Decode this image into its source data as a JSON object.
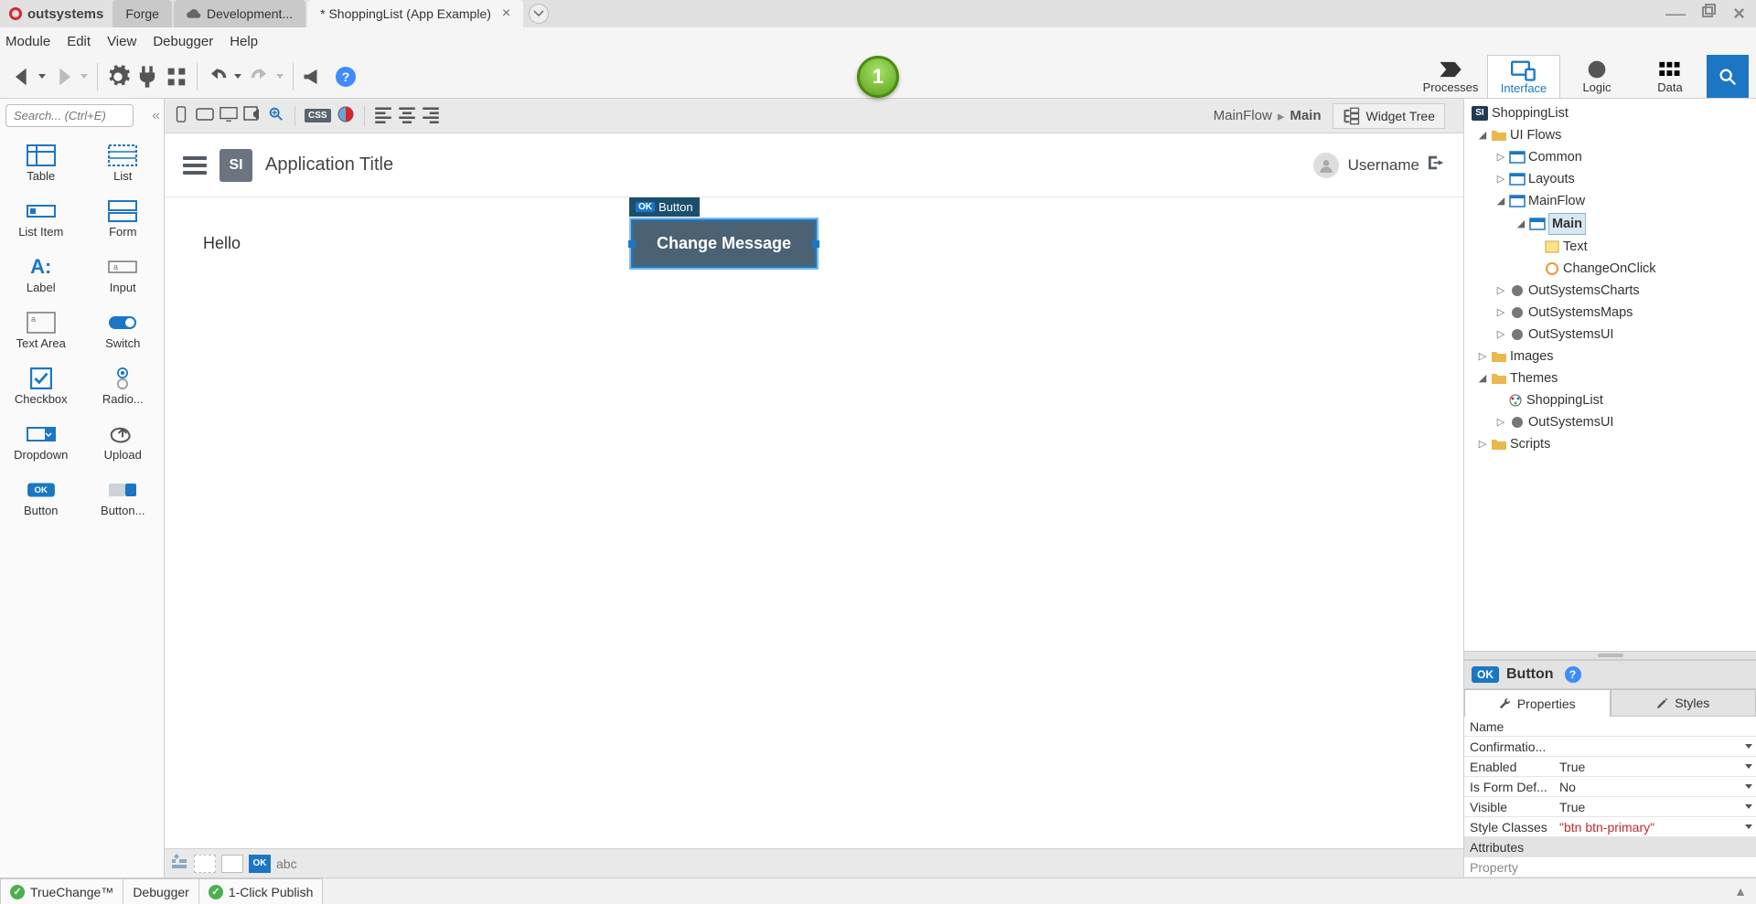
{
  "brand": "outsystems",
  "app_tabs": [
    {
      "label": "Forge"
    },
    {
      "label": "Development..."
    },
    {
      "label": "* ShoppingList (App Example)"
    }
  ],
  "menubar": [
    "Module",
    "Edit",
    "View",
    "Debugger",
    "Help"
  ],
  "step_number": "1",
  "top_tabs": {
    "processes": "Processes",
    "interface": "Interface",
    "logic": "Logic",
    "data": "Data"
  },
  "palette": {
    "search_placeholder": "Search... (Ctrl+E)",
    "items": [
      {
        "name": "Table"
      },
      {
        "name": "List"
      },
      {
        "name": "List Item"
      },
      {
        "name": "Form"
      },
      {
        "name": "Label"
      },
      {
        "name": "Input"
      },
      {
        "name": "Text Area"
      },
      {
        "name": "Switch"
      },
      {
        "name": "Checkbox"
      },
      {
        "name": "Radio..."
      },
      {
        "name": "Dropdown"
      },
      {
        "name": "Upload"
      },
      {
        "name": "Button"
      },
      {
        "name": "Button..."
      }
    ]
  },
  "breadcrumb": {
    "parent": "MainFlow",
    "current": "Main"
  },
  "widget_tree_btn": "Widget Tree",
  "canvas": {
    "app_title": "Application Title",
    "app_logo_text": "SI",
    "username": "Username",
    "hello_text": "Hello",
    "selected_widget_type": "Button",
    "selected_widget_label": "Change Message"
  },
  "abc_label": "abc",
  "tree": {
    "module": "ShoppingList",
    "ui_flows": "UI Flows",
    "common": "Common",
    "layouts": "Layouts",
    "mainflow": "MainFlow",
    "main": "Main",
    "text": "Text",
    "changeonclick": "ChangeOnClick",
    "oscharts": "OutSystemsCharts",
    "osmaps": "OutSystemsMaps",
    "osui": "OutSystemsUI",
    "images": "Images",
    "themes": "Themes",
    "shoppinglist_theme": "ShoppingList",
    "osui2": "OutSystemsUI",
    "scripts": "Scripts"
  },
  "props": {
    "header_type": "Button",
    "ok_badge": "OK",
    "tab_properties": "Properties",
    "tab_styles": "Styles",
    "rows": [
      {
        "k": "Name",
        "v": ""
      },
      {
        "k": "Confirmatio...",
        "v": "",
        "dd": true
      },
      {
        "k": "Enabled",
        "v": "True",
        "dd": true
      },
      {
        "k": "Is Form Def...",
        "v": "No",
        "dd": true
      },
      {
        "k": "Visible",
        "v": "True",
        "dd": true
      },
      {
        "k": "Style Classes",
        "v": "\"btn btn-primary\"",
        "dd": true,
        "red": true
      }
    ],
    "attributes_section": "Attributes",
    "property_row": "Property"
  },
  "statusbar": {
    "truechange": "TrueChange™",
    "debugger": "Debugger",
    "publish": "1-Click Publish"
  }
}
